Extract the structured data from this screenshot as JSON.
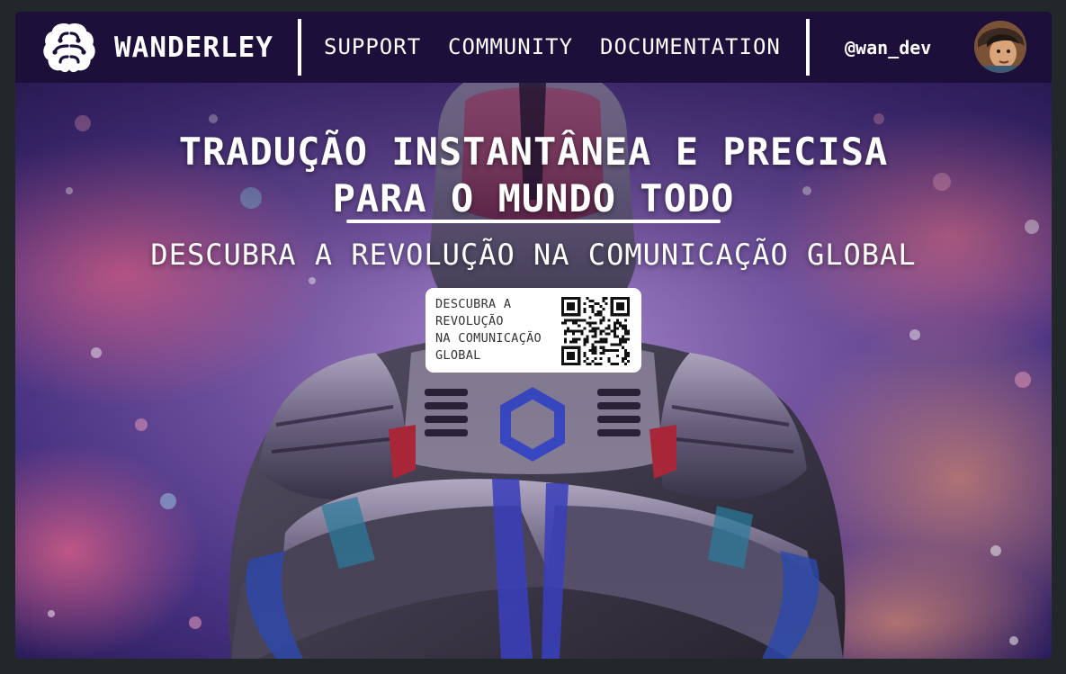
{
  "nav": {
    "brand": "WANDERLEY",
    "links": [
      "SUPPORT",
      "COMMUNITY",
      "DOCUMENTATION"
    ],
    "handle": "@wan_dev"
  },
  "hero": {
    "headline_line1": "TRADUÇÃO INSTANTÂNEA E PRECISA",
    "headline_line2": "PARA O MUNDO TODO",
    "subtitle": "DESCUBRA A REVOLUÇÃO NA COMUNICAÇÃO GLOBAL",
    "qr_card_lines": [
      "DESCUBRA A",
      "REVOLUÇÃO",
      "NA COMUNICAÇÃO",
      "GLOBAL"
    ]
  },
  "icons": {
    "logo": "brain-icon",
    "qr": "qr-code"
  },
  "colors": {
    "navbar": "#1c0f3a",
    "text": "#ffffff",
    "page_background": "#22272a"
  }
}
